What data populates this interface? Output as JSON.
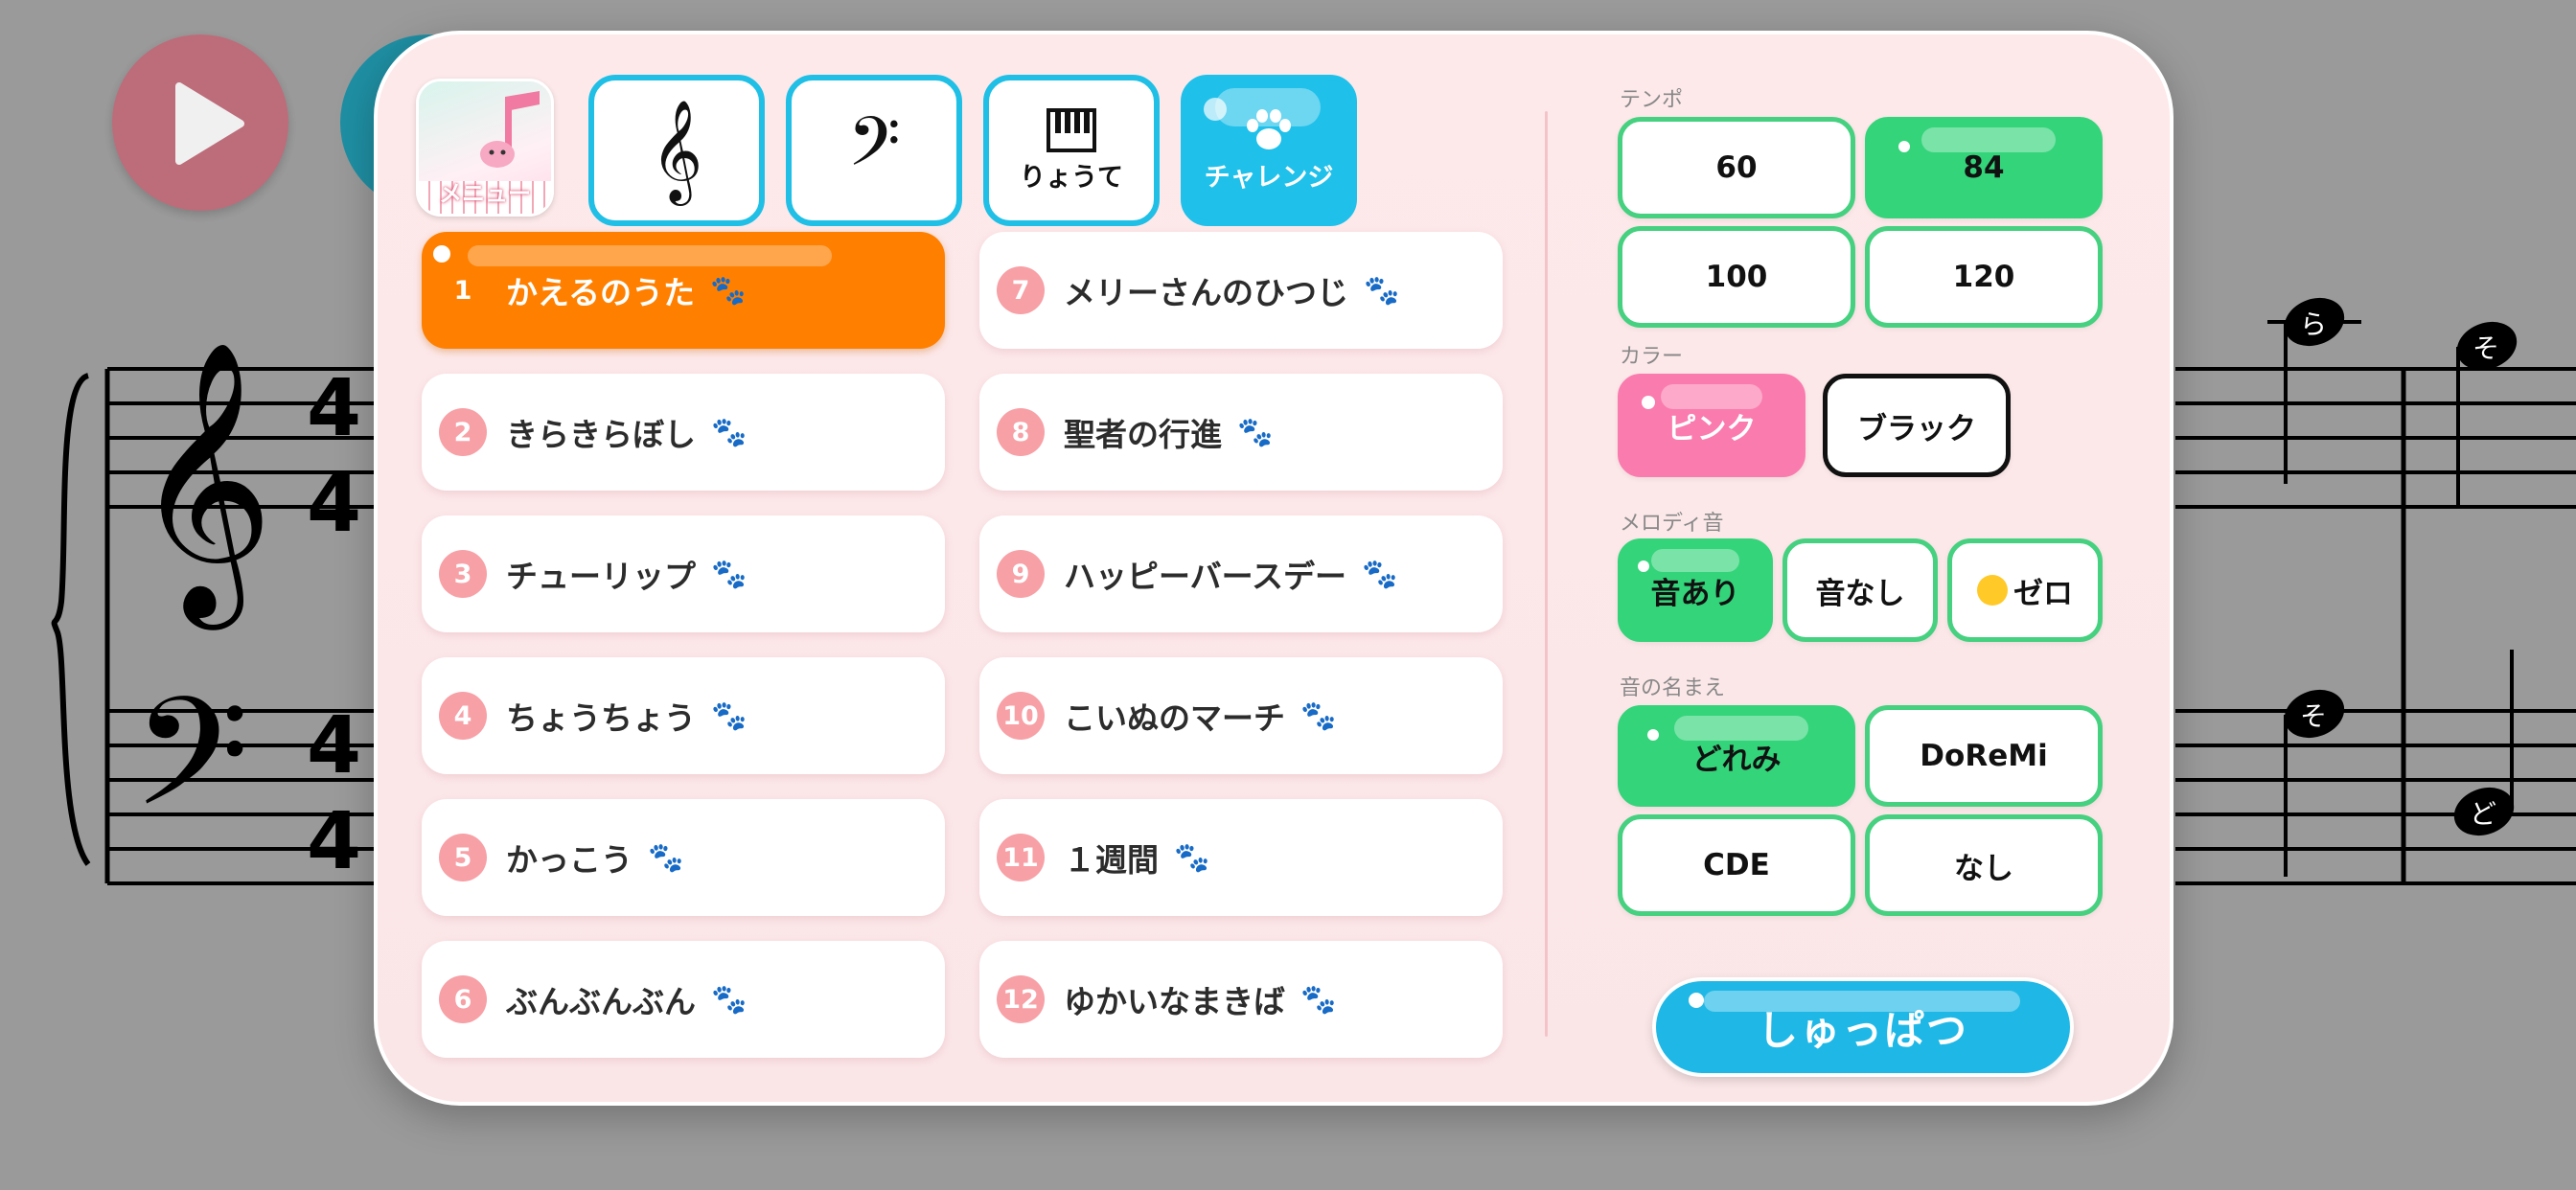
{
  "background": {
    "time_signature": [
      "4",
      "4",
      "4",
      "4"
    ],
    "note_names": [
      "ら",
      "そ",
      "そ",
      "ど"
    ]
  },
  "toolbar": {
    "menu_label": "メニュー",
    "treble_glyph": "𝄞",
    "bass_glyph": "𝄢",
    "both_hands_label": "りょうて",
    "challenge_label": "チャレンジ"
  },
  "songs": [
    {
      "num": "1",
      "title": "かえるのうた",
      "paw": "🐾"
    },
    {
      "num": "2",
      "title": "きらきらぼし",
      "paw": "🐾"
    },
    {
      "num": "3",
      "title": "チューリップ",
      "paw": "🐾"
    },
    {
      "num": "4",
      "title": "ちょうちょう",
      "paw": "🐾"
    },
    {
      "num": "5",
      "title": "かっこう",
      "paw": "🐾"
    },
    {
      "num": "6",
      "title": "ぶんぶんぶん",
      "paw": "🐾"
    },
    {
      "num": "7",
      "title": "メリーさんのひつじ",
      "paw": "🐾"
    },
    {
      "num": "8",
      "title": "聖者の行進",
      "paw": "🐾"
    },
    {
      "num": "9",
      "title": "ハッピーバースデー",
      "paw": "🐾"
    },
    {
      "num": "10",
      "title": "こいぬのマーチ",
      "paw": "🐾"
    },
    {
      "num": "11",
      "title": "１週間",
      "paw": "🐾"
    },
    {
      "num": "12",
      "title": "ゆかいなまきば",
      "paw": "🐾"
    }
  ],
  "settings": {
    "tempo": {
      "label": "テンポ",
      "options": [
        "60",
        "84",
        "100",
        "120"
      ],
      "selected": "84"
    },
    "color": {
      "label": "カラー",
      "options": [
        "ピンク",
        "ブラック"
      ],
      "selected": "ピンク"
    },
    "melody": {
      "label": "メロディ音",
      "options": [
        "音あり",
        "音なし",
        "ゼロ"
      ],
      "selected": "音あり"
    },
    "note_names": {
      "label": "音の名まえ",
      "options": [
        "どれみ",
        "DoReMi",
        "CDE",
        "なし"
      ],
      "selected": "どれみ"
    }
  },
  "start_label": "しゅっぱつ",
  "colors": {
    "accent_blue": "#1fc0ea",
    "selected_orange": "#ff8000",
    "green": "#34d47a",
    "pink": "#fa7bae"
  }
}
